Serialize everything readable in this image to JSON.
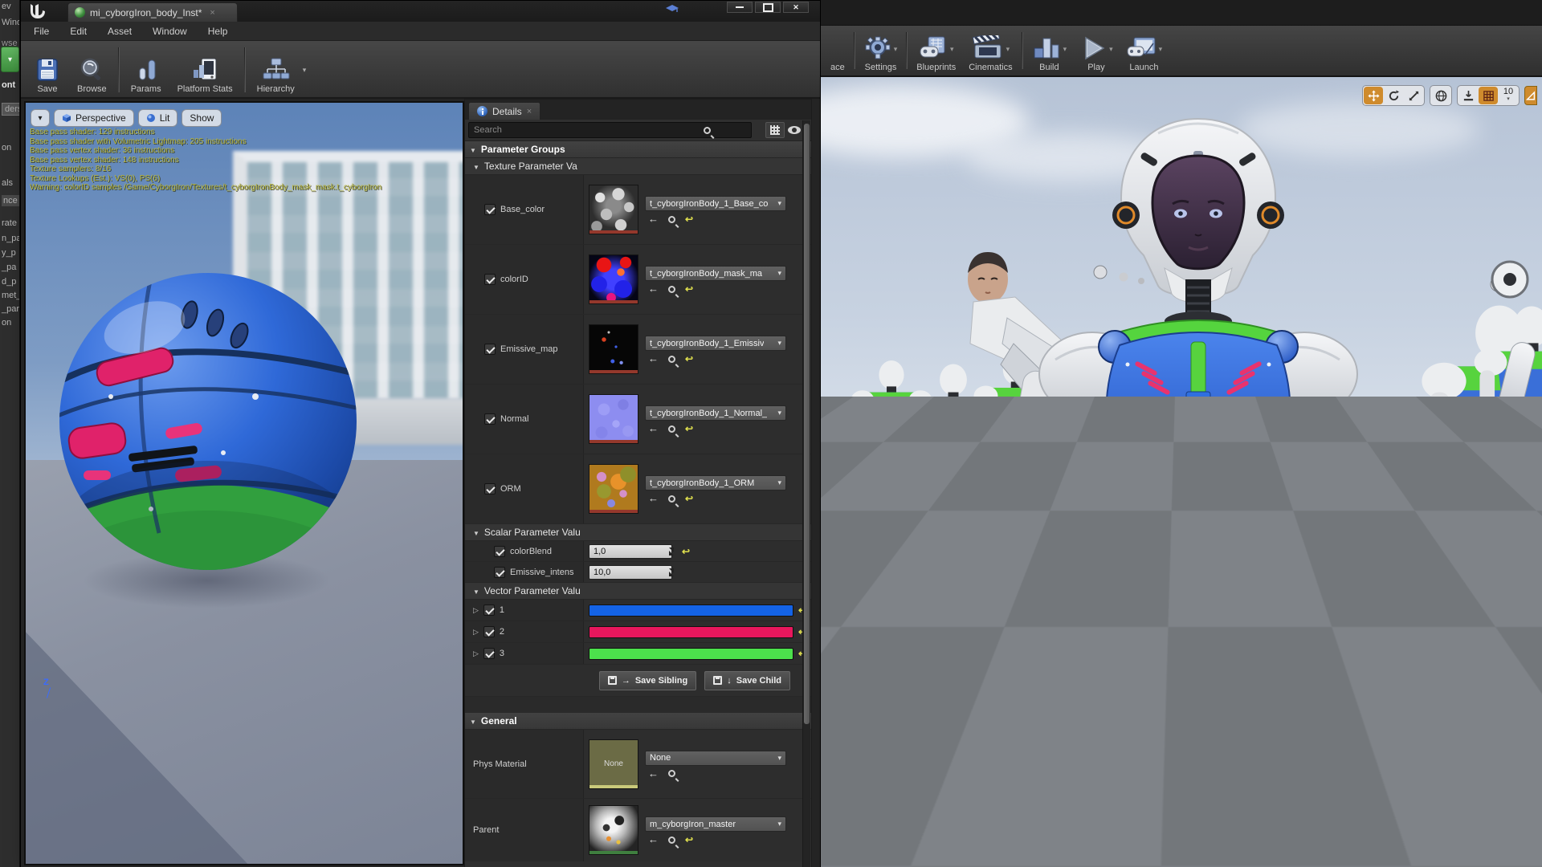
{
  "left_strip": {
    "fragments": [
      "ev",
      "Wind",
      "wse",
      "ont",
      "ders",
      "on",
      "als",
      "nce",
      "rate",
      "n_pa",
      "y_p",
      "_pa",
      "d_p",
      "met_",
      "_par",
      "on"
    ]
  },
  "material_editor": {
    "tab_title": "mi_cyborgIron_body_Inst*",
    "menu": [
      "File",
      "Edit",
      "Asset",
      "Window",
      "Help"
    ],
    "toolbar": [
      "Save",
      "Browse",
      "Params",
      "Platform Stats",
      "Hierarchy"
    ],
    "viewport": {
      "perspective_label": "Perspective",
      "lit_label": "Lit",
      "show_label": "Show",
      "stats": [
        "Base pass shader: 129 instructions",
        "Base pass shader with Volumetric Lightmap: 205 instructions",
        "Base pass vertex shader: 36 instructions",
        "Base pass vertex shader: 148 instructions",
        "Texture samplers: 8/16",
        "Texture Lookups (Est.): VS(0), PS(6)",
        "Warning: colorID samples /Game/CyborgIron/Textures/t_cyborgIronBody_mask_mask.t_cyborgIron"
      ],
      "axis_label": "Z"
    },
    "details": {
      "tab_label": "Details",
      "search_placeholder": "Search",
      "sections": {
        "parameter_groups": "Parameter Groups",
        "texture": "Texture Parameter Va",
        "scalar": "Scalar Parameter Valu",
        "vector": "Vector Parameter Valu",
        "general": "General"
      },
      "textures": [
        {
          "name": "Base_color",
          "asset": "t_cyborgIronBody_1_Base_co"
        },
        {
          "name": "colorID",
          "asset": "t_cyborgIronBody_mask_ma"
        },
        {
          "name": "Emissive_map",
          "asset": "t_cyborgIronBody_1_Emissiv"
        },
        {
          "name": "Normal",
          "asset": "t_cyborgIronBody_1_Normal_"
        },
        {
          "name": "ORM",
          "asset": "t_cyborgIronBody_1_ORM"
        }
      ],
      "scalars": [
        {
          "name": "colorBlend",
          "value": "1,0"
        },
        {
          "name": "Emissive_intens",
          "value": "10,0"
        }
      ],
      "vectors": [
        {
          "name": "1",
          "color": "#1463e6"
        },
        {
          "name": "2",
          "color": "#e8175d"
        },
        {
          "name": "3",
          "color": "#4ce04c"
        }
      ],
      "save_sibling_label": "Save Sibling",
      "save_child_label": "Save Child",
      "phys_material_label": "Phys Material",
      "phys_material_value": "None",
      "phys_material_thumb": "None",
      "parent_label": "Parent",
      "parent_value": "m_cyborgIron_master"
    }
  },
  "main_editor": {
    "toolbar": [
      "ace",
      "Settings",
      "Blueprints",
      "Cinematics",
      "Build",
      "Play",
      "Launch"
    ],
    "viewport": {
      "grid_snap_value": "10"
    }
  },
  "colors": {
    "accent_orange": "#cf8b2d",
    "stats_text": "#b9b63b",
    "vector_blue": "#1463e6",
    "vector_crimson": "#e8175d",
    "vector_green": "#4ce04c"
  }
}
